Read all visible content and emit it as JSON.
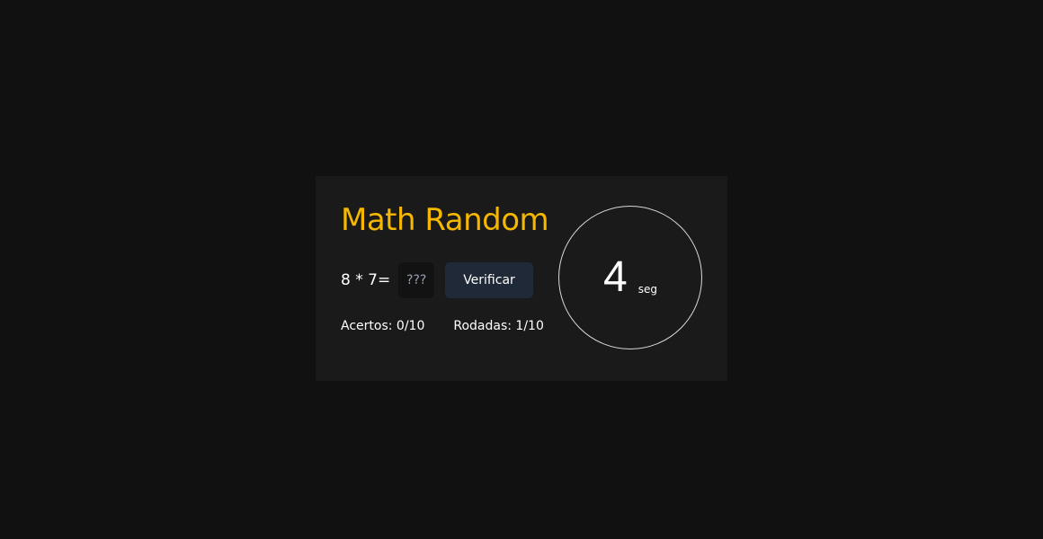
{
  "game": {
    "title": "Math Random",
    "expression": "8 * 7=",
    "answer_value": "",
    "answer_placeholder": "???",
    "verify_label": "Verificar",
    "hits_text": "Acertos: 0/10",
    "rounds_text": "Rodadas: 1/10",
    "timer_value": "4",
    "timer_unit": "seg"
  },
  "colors": {
    "background": "#111111",
    "card": "#1a1a1a",
    "title": "#f5b700",
    "button": "#1f2937",
    "text": "#ffffff"
  }
}
